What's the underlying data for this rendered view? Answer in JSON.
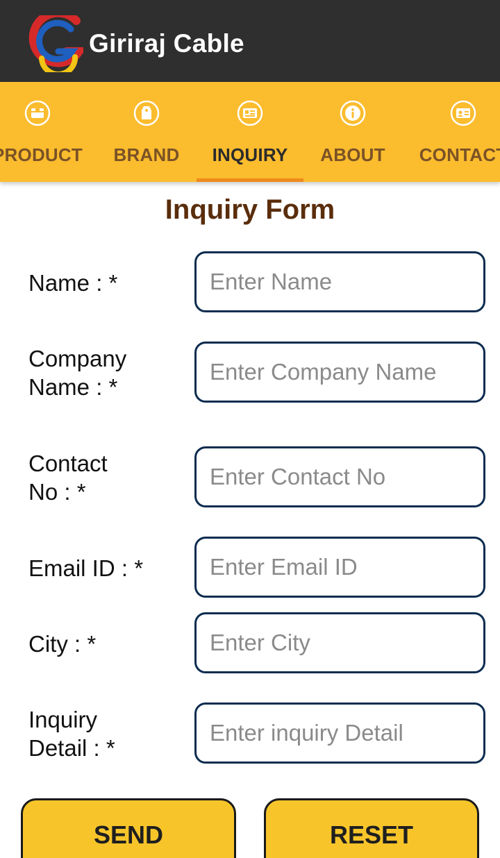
{
  "app": {
    "title": "Giriraj Cable"
  },
  "tabs": [
    {
      "label": "PRODUCT",
      "icon": "product-box-icon",
      "active": false
    },
    {
      "label": "BRAND",
      "icon": "brand-tag-icon",
      "active": false
    },
    {
      "label": "INQUIRY",
      "icon": "inquiry-card-icon",
      "active": true
    },
    {
      "label": "ABOUT",
      "icon": "info-icon",
      "active": false
    },
    {
      "label": "CONTACT",
      "icon": "contact-card-icon",
      "active": false
    }
  ],
  "form": {
    "title": "Inquiry Form",
    "fields": [
      {
        "label_line1": "Name : *",
        "label_line2": "",
        "placeholder": "Enter Name",
        "value": ""
      },
      {
        "label_line1": "Company",
        "label_line2": "Name : *",
        "placeholder": "Enter Company Name",
        "value": ""
      },
      {
        "label_line1": "Contact",
        "label_line2": "No : *",
        "placeholder": "Enter Contact No",
        "value": ""
      },
      {
        "label_line1": "Email ID : *",
        "label_line2": "",
        "placeholder": "Enter Email ID",
        "value": ""
      },
      {
        "label_line1": "City : *",
        "label_line2": "",
        "placeholder": "Enter City",
        "value": ""
      },
      {
        "label_line1": "Inquiry",
        "label_line2": "Detail : *",
        "placeholder": "Enter inquiry Detail",
        "value": ""
      }
    ],
    "send_label": "SEND",
    "reset_label": "RESET"
  },
  "colors": {
    "app_bar": "#2f2f2f",
    "tab_bar": "#fbbc2e",
    "tab_indicator": "#f08a1c",
    "form_title": "#5a2d0c",
    "input_border": "#0c2c4f",
    "button": "#f7c52a"
  }
}
